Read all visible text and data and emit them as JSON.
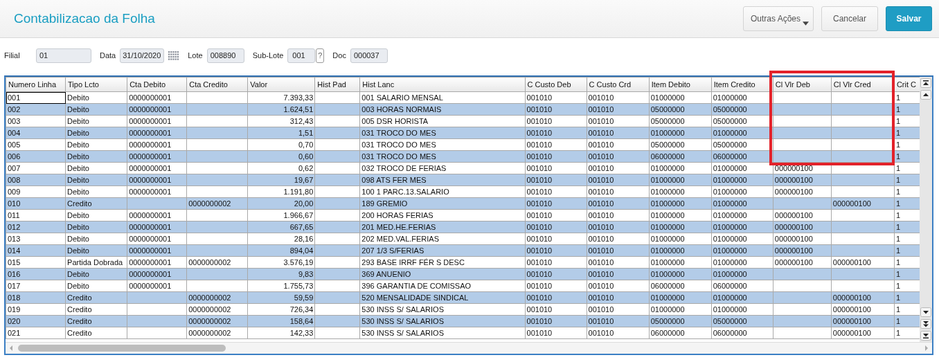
{
  "header": {
    "title": "Contabilizacao da Folha",
    "buttons": [
      {
        "label": "Outras Ações",
        "kind": "dropdown"
      },
      {
        "label": "Cancelar",
        "kind": "plain"
      },
      {
        "label": "Salvar",
        "kind": "primary"
      }
    ]
  },
  "fields": [
    {
      "label": "Filial",
      "value": "01",
      "kind": "text"
    },
    {
      "label": "Data",
      "value": "31/10/2020",
      "kind": "date"
    },
    {
      "label": "Lote",
      "value": "008890",
      "kind": "text"
    },
    {
      "label": "Sub-Lote",
      "value": "001",
      "kind": "lookup",
      "help": "?"
    },
    {
      "label": "Doc",
      "value": "000037",
      "kind": "text"
    }
  ],
  "table": {
    "annotation": {
      "kind": "box",
      "color": "#e3222a"
    },
    "columns": [
      "Numero Linha",
      "Tipo Lcto",
      "Cta Debito",
      "Cta Credito",
      "Valor",
      "Hist Pad",
      "Hist Lanc",
      "C Custo Deb",
      "C Custo Crd",
      "Item Debito",
      "Item Credito",
      "Cl Vlr Deb",
      "Cl Vlr Cred",
      "Crit C"
    ],
    "rows": [
      {
        "focused": true,
        "cells": [
          "001",
          "Debito",
          "0000000001",
          null,
          "7.393,33",
          null,
          "001 SALARIO MENSAL",
          "001010",
          "001010",
          "01000000",
          "01000000",
          null,
          null,
          "1"
        ]
      },
      {
        "focused": false,
        "cells": [
          "002",
          "Debito",
          "0000000001",
          null,
          "1.624,51",
          null,
          "003 HORAS NORMAIS",
          "001010",
          "001010",
          "05000000",
          "05000000",
          null,
          null,
          "1"
        ]
      },
      {
        "focused": false,
        "cells": [
          "003",
          "Debito",
          "0000000001",
          null,
          "312,43",
          null,
          "005 DSR HORISTA",
          "001010",
          "001010",
          "05000000",
          "05000000",
          null,
          null,
          "1"
        ]
      },
      {
        "focused": false,
        "cells": [
          "004",
          "Debito",
          "0000000001",
          null,
          "1,51",
          null,
          "031 TROCO DO MES",
          "001010",
          "001010",
          "01000000",
          "01000000",
          null,
          null,
          "1"
        ]
      },
      {
        "focused": false,
        "cells": [
          "005",
          "Debito",
          "0000000001",
          null,
          "0,70",
          null,
          "031 TROCO DO MES",
          "001010",
          "001010",
          "05000000",
          "05000000",
          null,
          null,
          "1"
        ]
      },
      {
        "focused": false,
        "cells": [
          "006",
          "Debito",
          "0000000001",
          null,
          "0,60",
          null,
          "031 TROCO DO MES",
          "001010",
          "001010",
          "06000000",
          "06000000",
          null,
          null,
          "1"
        ]
      },
      {
        "focused": false,
        "cells": [
          "007",
          "Debito",
          "0000000001",
          null,
          "0,62",
          null,
          "032 TROCO DE FERIAS",
          "001010",
          "001010",
          "01000000",
          "01000000",
          "000000100",
          null,
          "1"
        ]
      },
      {
        "focused": false,
        "cells": [
          "008",
          "Debito",
          "0000000001",
          null,
          "19,67",
          null,
          "098 ATS FER MES",
          "001010",
          "001010",
          "01000000",
          "01000000",
          "000000100",
          null,
          "1"
        ]
      },
      {
        "focused": false,
        "cells": [
          "009",
          "Debito",
          "0000000001",
          null,
          "1.191,80",
          null,
          "100 1 PARC.13.SALARIO",
          "001010",
          "001010",
          "01000000",
          "01000000",
          "000000100",
          null,
          "1"
        ]
      },
      {
        "focused": false,
        "cells": [
          "010",
          "Credito",
          null,
          "0000000002",
          "20,00",
          null,
          "189 GREMIO",
          "001010",
          "001010",
          "01000000",
          "01000000",
          null,
          "000000100",
          "1"
        ]
      },
      {
        "focused": false,
        "cells": [
          "011",
          "Debito",
          "0000000001",
          null,
          "1.966,67",
          null,
          "200 HORAS FERIAS",
          "001010",
          "001010",
          "01000000",
          "01000000",
          "000000100",
          null,
          "1"
        ]
      },
      {
        "focused": false,
        "cells": [
          "012",
          "Debito",
          "0000000001",
          null,
          "667,65",
          null,
          "201 MED.HE.FERIAS",
          "001010",
          "001010",
          "01000000",
          "01000000",
          "000000100",
          null,
          "1"
        ]
      },
      {
        "focused": false,
        "cells": [
          "013",
          "Debito",
          "0000000001",
          null,
          "28,16",
          null,
          "202 MED.VAL.FERIAS",
          "001010",
          "001010",
          "01000000",
          "01000000",
          "000000100",
          null,
          "1"
        ]
      },
      {
        "focused": false,
        "cells": [
          "014",
          "Debito",
          "0000000001",
          null,
          "894,04",
          null,
          "207 1/3 S/FERIAS",
          "001010",
          "001010",
          "01000000",
          "01000000",
          "000000100",
          null,
          "1"
        ]
      },
      {
        "focused": false,
        "cells": [
          "015",
          "Partida Dobrada",
          "0000000001",
          "0000000002",
          "3.576,19",
          null,
          "293 BASE IRRF FÉR S DESC",
          "001010",
          "001010",
          "01000000",
          "01000000",
          "000000100",
          "000000100",
          "1"
        ]
      },
      {
        "focused": false,
        "cells": [
          "016",
          "Debito",
          "0000000001",
          null,
          "9,83",
          null,
          "369 ANUENIO",
          "001010",
          "001010",
          "01000000",
          "01000000",
          null,
          null,
          "1"
        ]
      },
      {
        "focused": false,
        "cells": [
          "017",
          "Debito",
          "0000000001",
          null,
          "1.755,73",
          null,
          "396 GARANTIA DE COMISSAO",
          "001010",
          "001010",
          "06000000",
          "06000000",
          null,
          null,
          "1"
        ]
      },
      {
        "focused": false,
        "cells": [
          "018",
          "Credito",
          null,
          "0000000002",
          "59,59",
          null,
          "520 MENSALIDADE SINDICAL",
          "001010",
          "001010",
          "01000000",
          "01000000",
          null,
          "000000100",
          "1"
        ]
      },
      {
        "focused": false,
        "cells": [
          "019",
          "Credito",
          null,
          "0000000002",
          "726,34",
          null,
          "530 INSS S/ SALARIOS",
          "001010",
          "001010",
          "01000000",
          "01000000",
          null,
          "000000100",
          "1"
        ]
      },
      {
        "focused": false,
        "cells": [
          "020",
          "Credito",
          null,
          "0000000002",
          "158,64",
          null,
          "530 INSS S/ SALARIOS",
          "001010",
          "001010",
          "05000000",
          "05000000",
          null,
          "000000100",
          "1"
        ]
      },
      {
        "focused": false,
        "cells": [
          "021",
          "Credito",
          null,
          "0000000002",
          "142,33",
          null,
          "530 INSS S/ SALARIOS",
          "001010",
          "001010",
          "06000000",
          "06000000",
          null,
          "000000100",
          "1"
        ]
      }
    ]
  }
}
